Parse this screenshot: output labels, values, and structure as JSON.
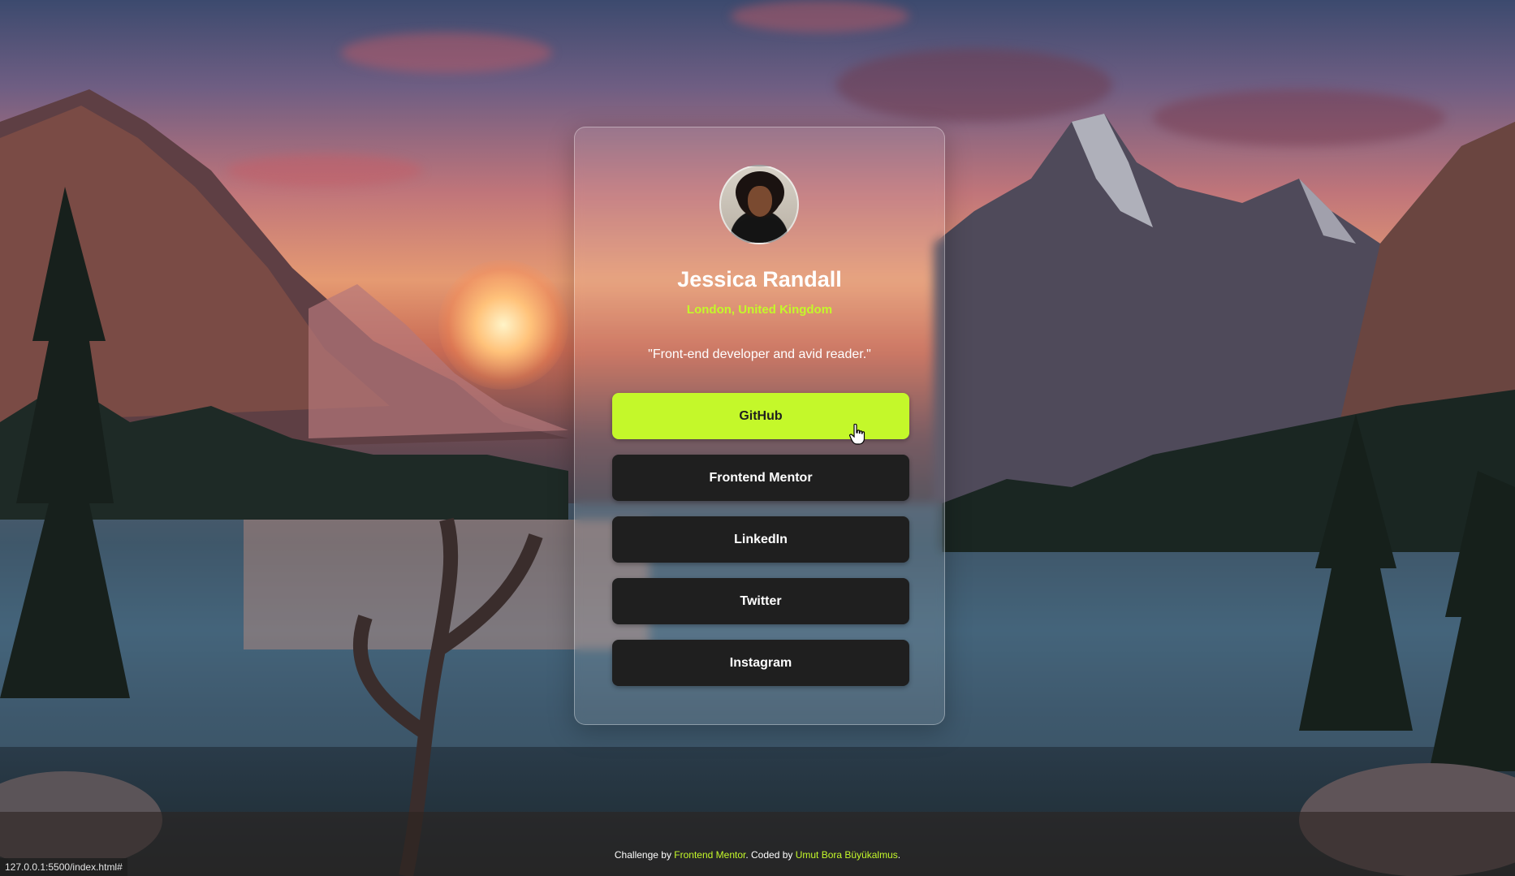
{
  "profile": {
    "name": "Jessica Randall",
    "location": "London, United Kingdom",
    "bio": "\"Front-end developer and avid reader.\""
  },
  "links": [
    {
      "label": "GitHub",
      "state": "hover"
    },
    {
      "label": "Frontend Mentor",
      "state": "default"
    },
    {
      "label": "LinkedIn",
      "state": "default"
    },
    {
      "label": "Twitter",
      "state": "default"
    },
    {
      "label": "Instagram",
      "state": "default"
    }
  ],
  "footer": {
    "prefix": "Challenge by ",
    "challenge_link": "Frontend Mentor",
    "middle": ". Coded by ",
    "author_link": "Umut Bora Büyükalmus",
    "suffix": "."
  },
  "status_bar": {
    "url": "127.0.0.1:5500/index.html#"
  },
  "colors": {
    "accent": "#c4f82a",
    "button_bg": "#1f1f1f",
    "text": "#ffffff"
  },
  "icons": {
    "cursor": "hand-pointer-icon"
  }
}
